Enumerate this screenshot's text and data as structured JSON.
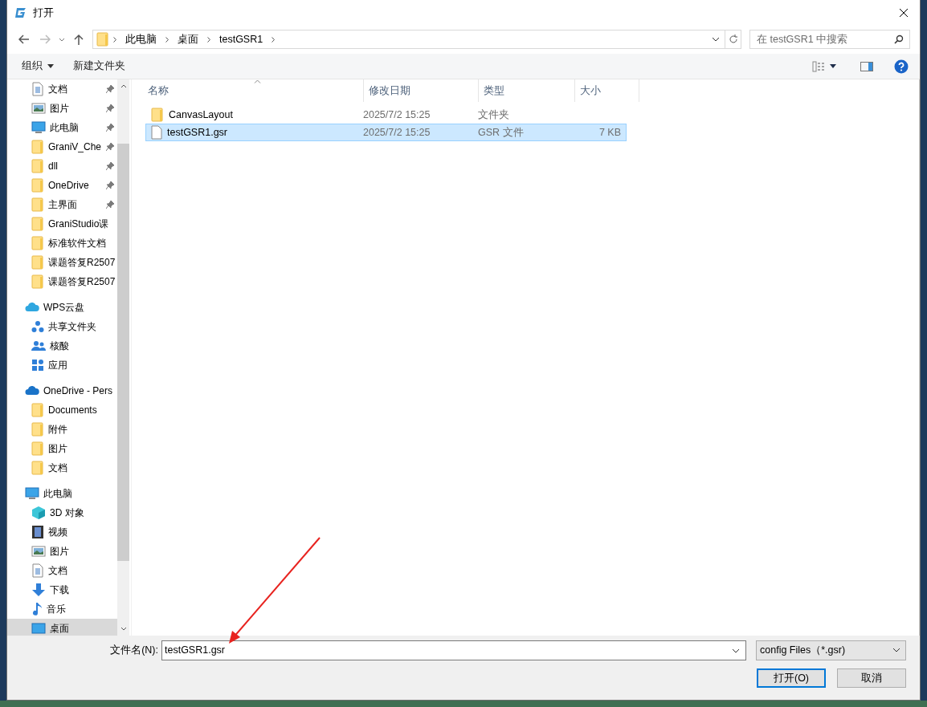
{
  "window": {
    "title": "打开"
  },
  "address_bar": {
    "path": [
      {
        "label": "此电脑"
      },
      {
        "label": "桌面"
      },
      {
        "label": "testGSR1"
      }
    ]
  },
  "search": {
    "placeholder": "在 testGSR1 中搜索"
  },
  "toolbar": {
    "buttons": [
      {
        "label": "组织",
        "dropdown": true
      },
      {
        "label": "新建文件夹",
        "dropdown": false
      }
    ]
  },
  "sidebar": {
    "sections": [
      {
        "items": [
          {
            "label": "文档",
            "kind": "document",
            "pinned": true,
            "selected": false
          },
          {
            "label": "图片",
            "kind": "pictures",
            "pinned": true,
            "selected": false
          },
          {
            "label": "此电脑",
            "kind": "computer",
            "pinned": true,
            "selected": false
          },
          {
            "label": "GraniV_Che",
            "kind": "folder",
            "pinned": true,
            "selected": false
          },
          {
            "label": "dll",
            "kind": "folder",
            "pinned": true,
            "selected": false
          },
          {
            "label": "OneDrive",
            "kind": "folder",
            "pinned": true,
            "selected": false
          },
          {
            "label": "主界面",
            "kind": "folder",
            "pinned": true,
            "selected": false
          },
          {
            "label": "GraniStudio课",
            "kind": "folder",
            "pinned": false,
            "selected": false
          },
          {
            "label": "标准软件文档",
            "kind": "folder",
            "pinned": false,
            "selected": false
          },
          {
            "label": "课题答复R2507",
            "kind": "folder",
            "pinned": false,
            "selected": false
          },
          {
            "label": "课题答复R2507",
            "kind": "folder",
            "pinned": false,
            "selected": false
          }
        ]
      },
      {
        "header": {
          "label": "WPS云盘",
          "kind": "cloud",
          "selected": false
        },
        "items": [
          {
            "label": "共享文件夹",
            "kind": "share",
            "pinned": false,
            "selected": false
          },
          {
            "label": "核酸",
            "kind": "people",
            "pinned": false,
            "selected": false
          },
          {
            "label": "应用",
            "kind": "apps",
            "pinned": false,
            "selected": false
          }
        ]
      },
      {
        "header": {
          "label": "OneDrive - Pers",
          "kind": "onedrive",
          "selected": false
        },
        "items": [
          {
            "label": "Documents",
            "kind": "folder",
            "pinned": false,
            "selected": false
          },
          {
            "label": "附件",
            "kind": "folder",
            "pinned": false,
            "selected": false
          },
          {
            "label": "图片",
            "kind": "folder",
            "pinned": false,
            "selected": false
          },
          {
            "label": "文档",
            "kind": "folder",
            "pinned": false,
            "selected": false
          }
        ]
      },
      {
        "header": {
          "label": "此电脑",
          "kind": "computer",
          "selected": false
        },
        "items": [
          {
            "label": "3D 对象",
            "kind": "cube",
            "pinned": false,
            "selected": false
          },
          {
            "label": "视频",
            "kind": "video",
            "pinned": false,
            "selected": false
          },
          {
            "label": "图片",
            "kind": "pictures",
            "pinned": false,
            "selected": false
          },
          {
            "label": "文档",
            "kind": "document",
            "pinned": false,
            "selected": false
          },
          {
            "label": "下载",
            "kind": "download",
            "pinned": false,
            "selected": false
          },
          {
            "label": "音乐",
            "kind": "music",
            "pinned": false,
            "selected": false
          },
          {
            "label": "桌面",
            "kind": "desktop",
            "pinned": false,
            "selected": true
          }
        ]
      }
    ]
  },
  "file_list": {
    "columns": [
      {
        "label": "名称",
        "sorted": true
      },
      {
        "label": "修改日期",
        "sorted": false
      },
      {
        "label": "类型",
        "sorted": false
      },
      {
        "label": "大小",
        "sorted": false
      }
    ],
    "rows": [
      {
        "kind": "folder",
        "name": "CanvasLayout",
        "modified": "2025/7/2 15:25",
        "type": "文件夹",
        "selected": false
      },
      {
        "kind": "file",
        "name": "testGSR1.gsr",
        "modified": "2025/7/2 15:25",
        "type": "GSR 文件",
        "size": "7 KB",
        "selected": true
      }
    ]
  },
  "footer": {
    "filename_label": "文件名(N):",
    "filename": "testGSR1.gsr",
    "filetype": "config Files（*.gsr)",
    "buttons": [
      {
        "label": "打开(O)",
        "default": true
      },
      {
        "label": "取消",
        "default": false
      }
    ]
  }
}
